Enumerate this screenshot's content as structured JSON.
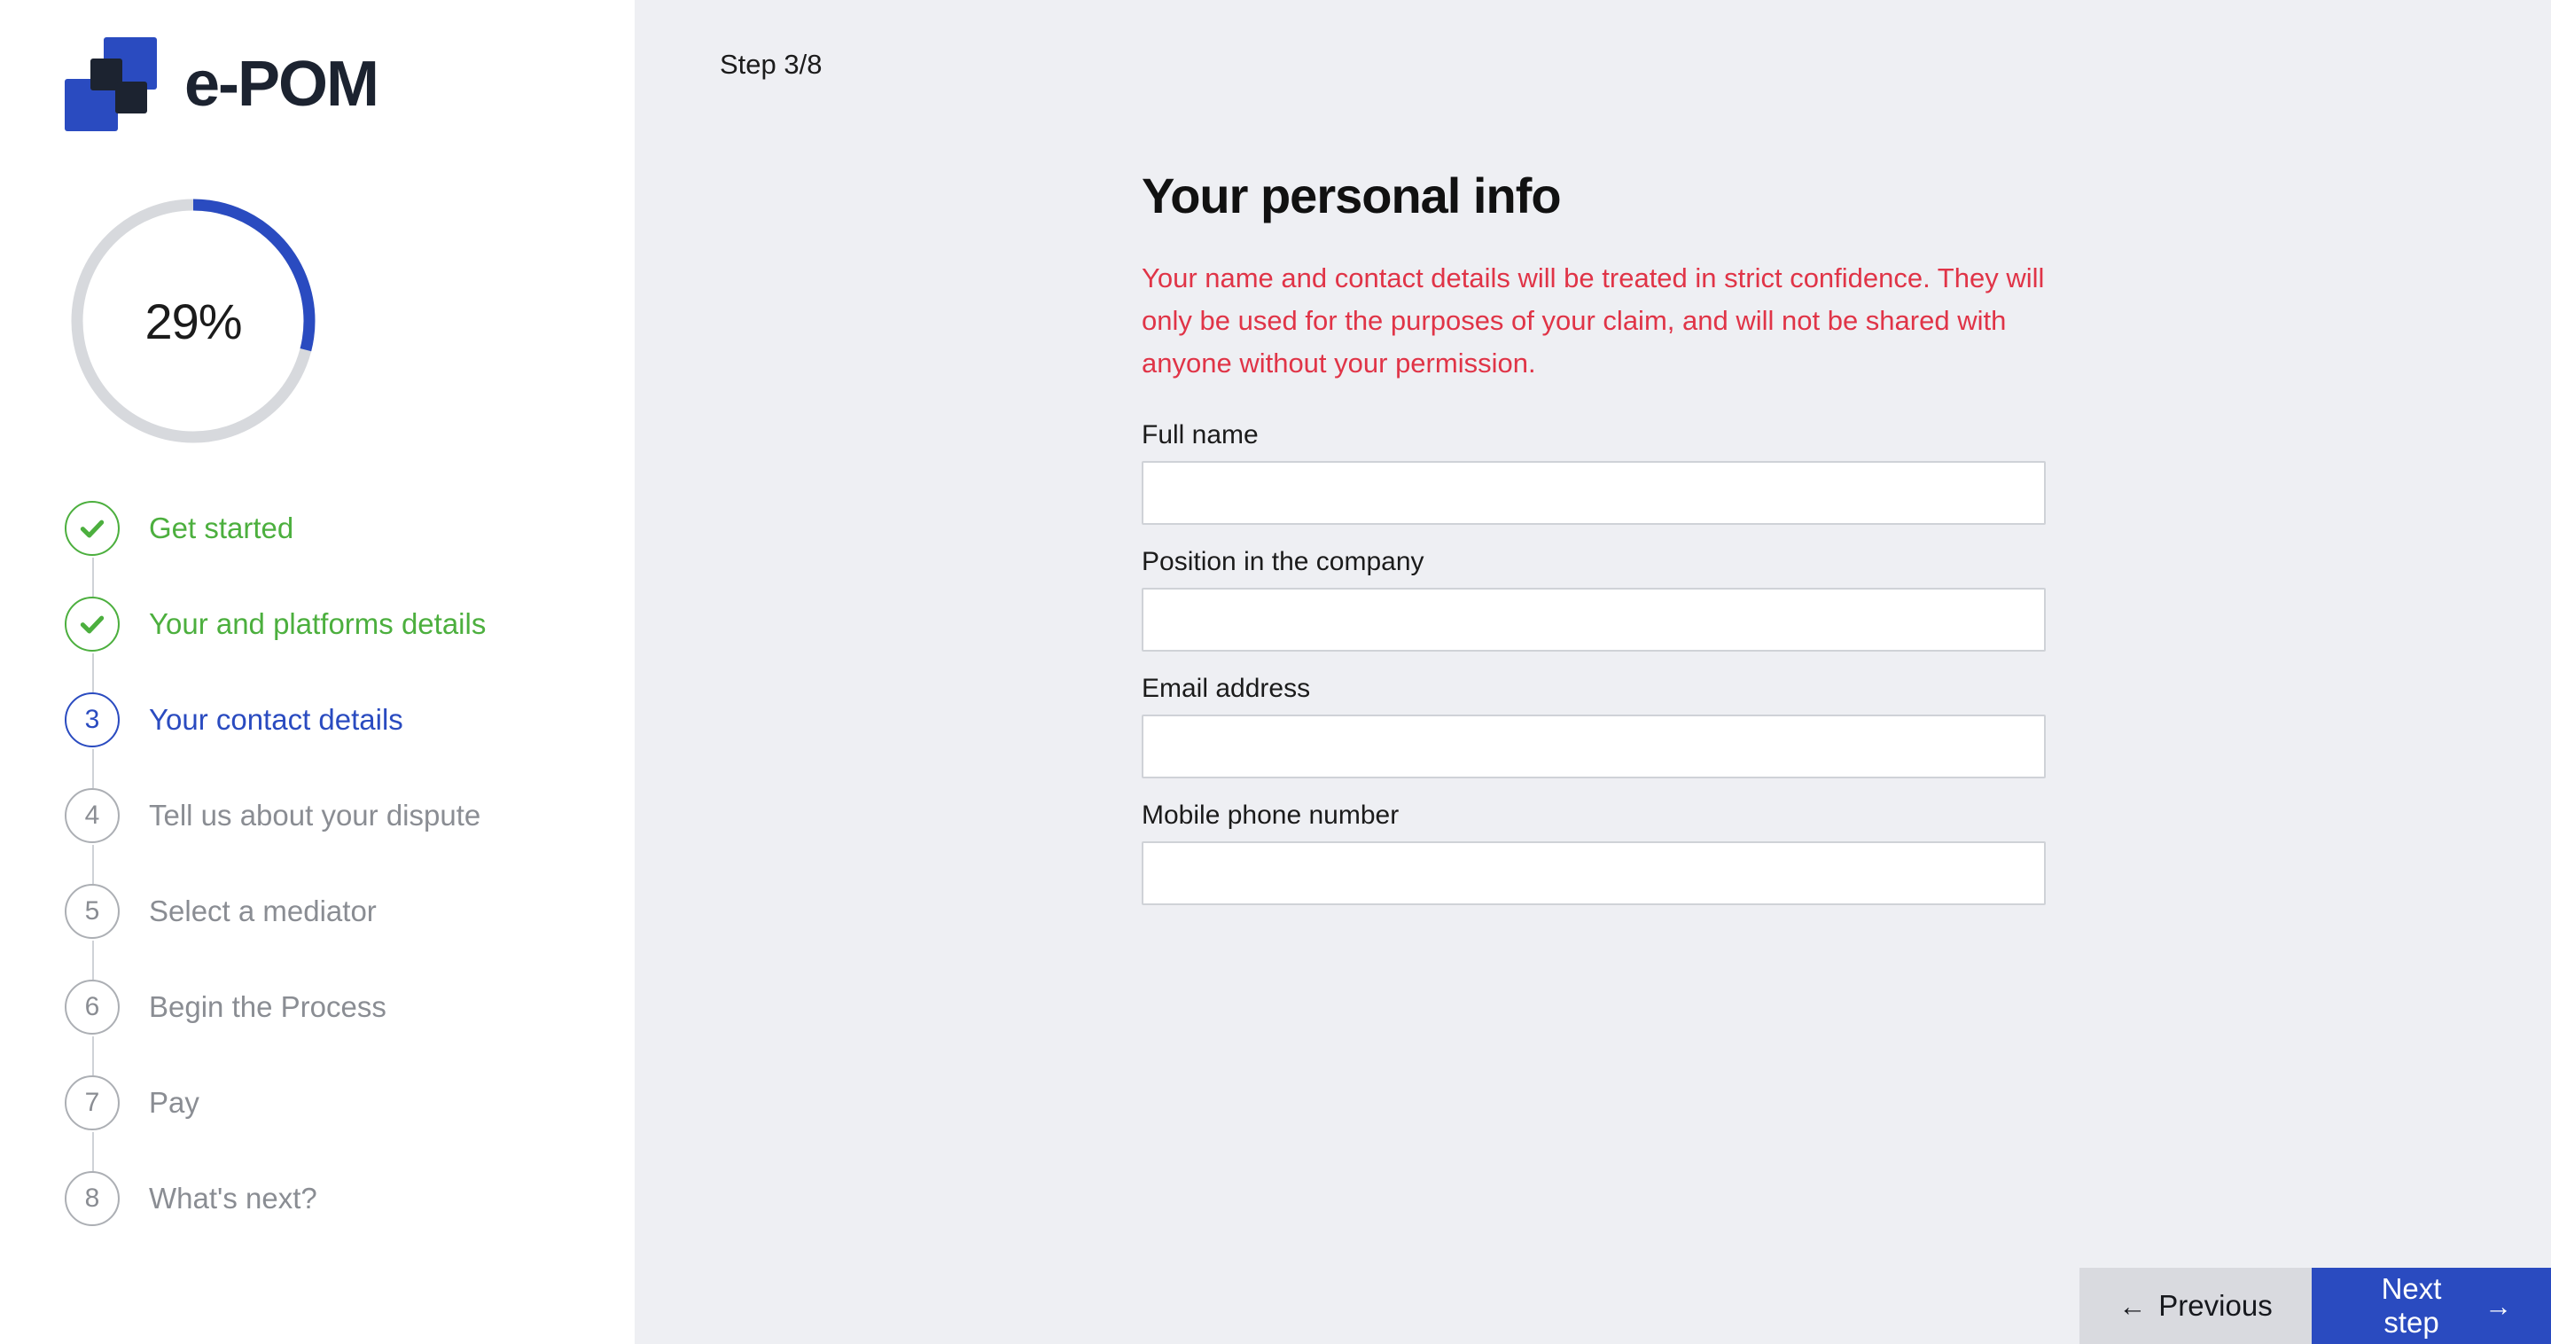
{
  "brand": {
    "name": "e-POM",
    "logo_icon": "epom-checker-squares-icon",
    "mark_color_blue": "#2A4BC0",
    "mark_color_dark": "#1C2330"
  },
  "progress": {
    "percent_label": "29%",
    "percent_value": 29,
    "track_color": "#D7D9DD",
    "fill_color": "#2A4BC0"
  },
  "steps": [
    {
      "number": "1",
      "label": "Get started",
      "state": "done",
      "icon": "check-icon"
    },
    {
      "number": "2",
      "label": "Your and platforms details",
      "state": "done",
      "icon": "check-icon"
    },
    {
      "number": "3",
      "label": "Your contact details",
      "state": "active",
      "icon": ""
    },
    {
      "number": "4",
      "label": "Tell us about your dispute",
      "state": "todo",
      "icon": ""
    },
    {
      "number": "5",
      "label": "Select a mediator",
      "state": "todo",
      "icon": ""
    },
    {
      "number": "6",
      "label": "Begin the Process",
      "state": "todo",
      "icon": ""
    },
    {
      "number": "7",
      "label": "Pay",
      "state": "todo",
      "icon": ""
    },
    {
      "number": "8",
      "label": "What's next?",
      "state": "todo",
      "icon": ""
    }
  ],
  "main": {
    "step_counter": "Step 3/8",
    "title": "Your personal info",
    "notice": "Your name and contact details will be treated in strict confidence. They will only be used for the purposes of your claim, and will not be shared with anyone without your permission.",
    "notice_color": "#E03447",
    "fields": [
      {
        "label": "Full name",
        "value": "",
        "placeholder": ""
      },
      {
        "label": "Position in the company",
        "value": "",
        "placeholder": ""
      },
      {
        "label": "Email address",
        "value": "",
        "placeholder": ""
      },
      {
        "label": "Mobile phone number",
        "value": "",
        "placeholder": ""
      }
    ]
  },
  "nav": {
    "previous_label": "Previous",
    "previous_arrow": "←",
    "next_label": "Next step",
    "next_arrow": "→",
    "next_color": "#2A4BC0",
    "previous_color": "#D9DADF"
  },
  "colors": {
    "accent_blue": "#2A4BC0",
    "success_green": "#4CAF3E",
    "danger_red": "#E03447",
    "muted_gray": "#8A8D93",
    "main_background": "#EEEFF3",
    "sidebar_background": "#FFFFFF"
  }
}
